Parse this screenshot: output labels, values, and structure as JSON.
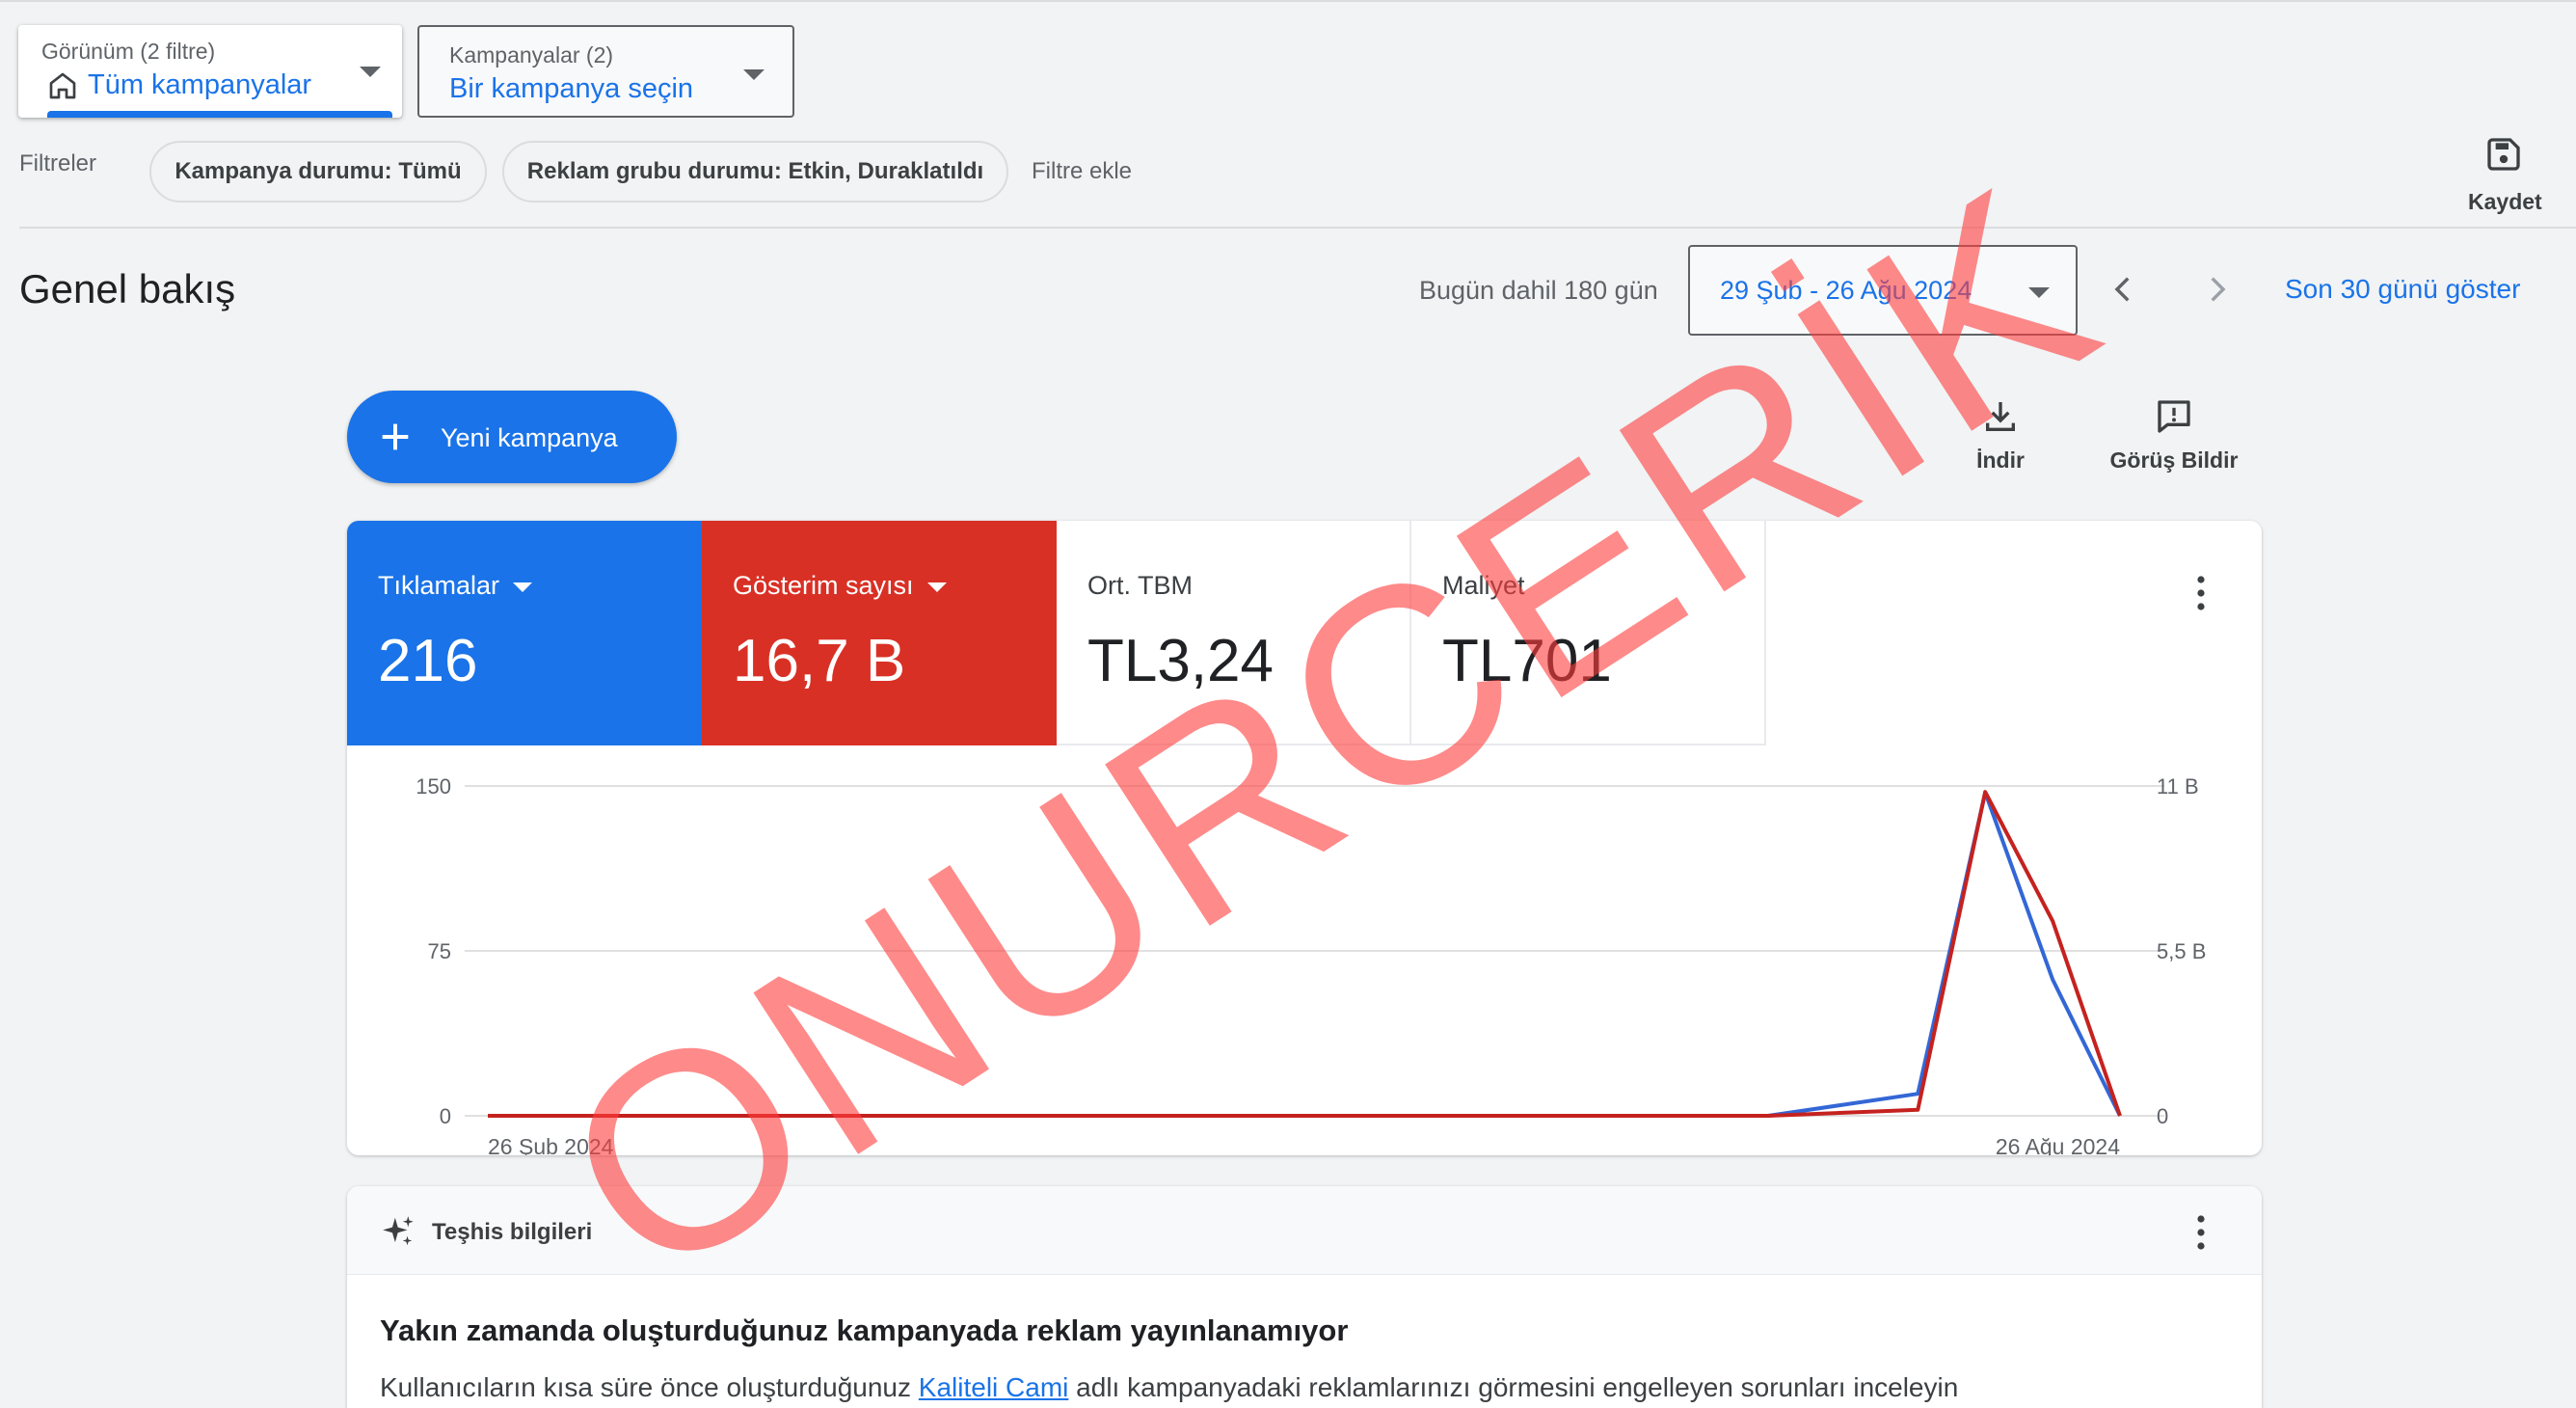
{
  "view_dropdown": {
    "label": "Görünüm (2 filtre)",
    "value": "Tüm kampanyalar"
  },
  "campaign_dropdown": {
    "label": "Kampanyalar (2)",
    "value": "Bir kampanya seçin"
  },
  "filters": {
    "label": "Filtreler",
    "chips": [
      "Kampanya durumu: Tümü",
      "Reklam grubu durumu: Etkin, Duraklatıldı"
    ],
    "add_label": "Filtre ekle"
  },
  "save_label": "Kaydet",
  "overview": {
    "title": "Genel bakış",
    "range_label": "Bugün dahil 180 gün",
    "date_range": "29 Şub - 26 Ağu 2024",
    "last30_label": "Son 30 günü göster"
  },
  "new_campaign_label": "Yeni kampanya",
  "tools": {
    "download_label": "İndir",
    "feedback_label": "Görüş Bildir"
  },
  "metrics": [
    {
      "label": "Tıklamalar",
      "value": "216",
      "color": "#1a73e8"
    },
    {
      "label": "Gösterim sayısı",
      "value": "16,7 B",
      "color": "#d93025"
    },
    {
      "label": "Ort. TBM",
      "value": "TL3,24"
    },
    {
      "label": "Maliyet",
      "value": "TL701"
    }
  ],
  "chart_data": {
    "type": "line",
    "x": [
      "26 Şub 2024",
      "…",
      "26 Ağu 2024"
    ],
    "x_tick_labels": [
      "26 Şub 2024",
      "26 Ağu 2024"
    ],
    "y_left_ticks": [
      "0",
      "75",
      "150"
    ],
    "y_right_ticks": [
      "0",
      "5,5 B",
      "11 B"
    ],
    "y_left_range": [
      0,
      150
    ],
    "y_right_range": [
      0,
      11
    ],
    "grid": true,
    "series": [
      {
        "name": "Tıklamalar",
        "axis": "left",
        "color": "#3367d6",
        "points": [
          [
            0,
            0
          ],
          [
            0.855,
            0
          ],
          [
            0.955,
            10
          ],
          [
            1.0,
            147
          ],
          [
            1.045,
            62
          ],
          [
            1.09,
            0
          ]
        ]
      },
      {
        "name": "Gösterim sayısı",
        "axis": "right",
        "color": "#c5221f",
        "points": [
          [
            0,
            0
          ],
          [
            0.855,
            0
          ],
          [
            0.955,
            0.2
          ],
          [
            1.0,
            10.8
          ],
          [
            1.045,
            6.5
          ],
          [
            1.09,
            0
          ]
        ]
      }
    ]
  },
  "diagnostics": {
    "title": "Teşhis bilgileri",
    "heading": "Yakın zamanda oluşturduğunuz kampanyada reklam yayınlanamıyor",
    "body_before": "Kullanıcıların kısa süre önce oluşturduğunuz ",
    "body_link": "Kaliteli Cami",
    "body_after": " adlı kampanyadaki reklamlarınızı görmesini engelleyen sorunları inceleyin"
  },
  "watermark": "ONURCERİK"
}
